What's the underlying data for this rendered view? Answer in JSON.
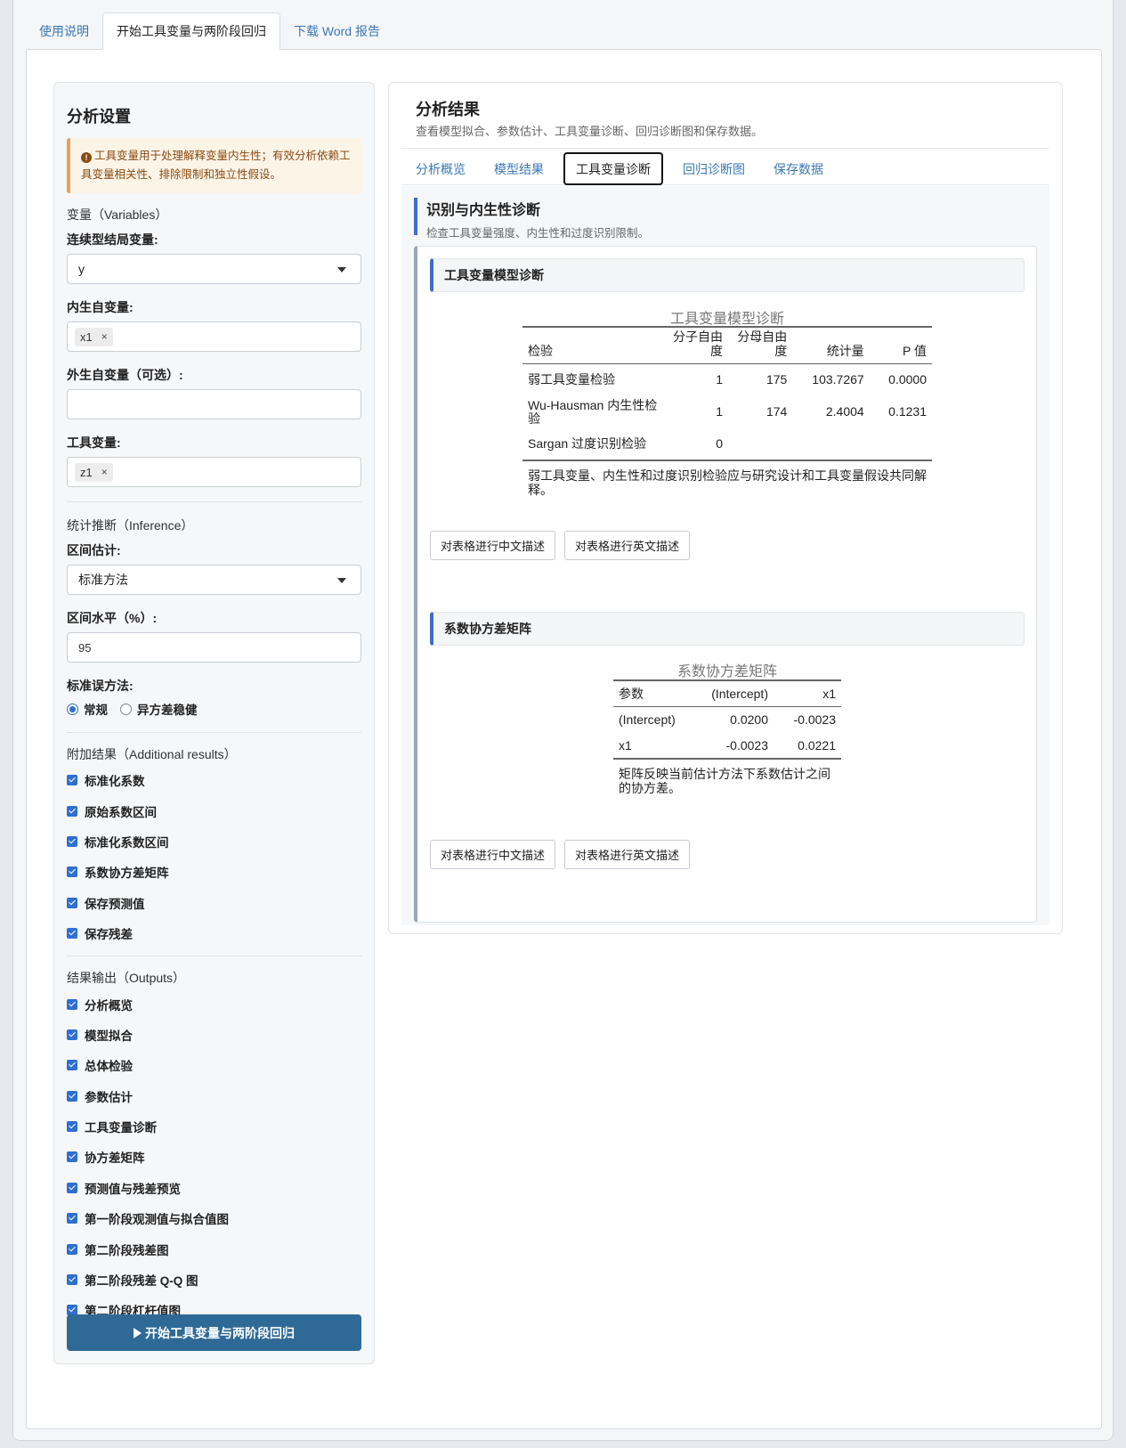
{
  "top_tabs": [
    "使用说明",
    "开始工具变量与两阶段回归",
    "下载 Word 报告"
  ],
  "sidebar": {
    "title": "分析设置",
    "alert": "工具变量用于处理解释变量内生性；有效分析依赖工具变量相关性、排除限制和独立性假设。",
    "variables_title": "变量（Variables）",
    "outcome_label": "连续型结局变量:",
    "outcome_value": "y",
    "endog_label": "内生自变量:",
    "endog_tag": "x1",
    "exog_label": "外生自变量（可选）:",
    "instr_label": "工具变量:",
    "instr_tag": "z1",
    "inference_title": "统计推断（Inference）",
    "interval_label": "区间估计:",
    "interval_value": "标准方法",
    "level_label": "区间水平（%）:",
    "level_value": "95",
    "se_label": "标准误方法:",
    "se_options": [
      "常规",
      "异方差稳健"
    ],
    "se_selected": "常规",
    "additional_title": "附加结果（Additional results）",
    "additional_items": [
      "标准化系数",
      "原始系数区间",
      "标准化系数区间",
      "系数协方差矩阵",
      "保存预测值",
      "保存残差"
    ],
    "outputs_title": "结果输出（Outputs）",
    "output_items": [
      "分析概览",
      "模型拟合",
      "总体检验",
      "参数估计",
      "工具变量诊断",
      "协方差矩阵",
      "预测值与残差预览",
      "第一阶段观测值与拟合值图",
      "第二阶段残差图",
      "第二阶段残差 Q-Q 图",
      "第二阶段杠杆值图"
    ],
    "run_button": "开始工具变量与两阶段回归"
  },
  "results": {
    "title": "分析结果",
    "subtitle": "查看模型拟合、参数估计、工具变量诊断、回归诊断图和保存数据。",
    "tabs": [
      "分析概览",
      "模型结果",
      "工具变量诊断",
      "回归诊断图",
      "保存数据"
    ],
    "active_tab": "工具变量诊断",
    "section_title": "识别与内生性诊断",
    "section_subtitle": "检查工具变量强度、内生性和过度识别限制。",
    "diag": {
      "card_title": "工具变量模型诊断",
      "caption": "工具变量模型诊断",
      "headers": [
        "检验",
        "分子自由度",
        "分母自由度",
        "统计量",
        "P 值"
      ],
      "rows": [
        [
          "弱工具变量检验",
          "1",
          "175",
          "103.7267",
          "0.0000"
        ],
        [
          "Wu-Hausman 内生性检验",
          "1",
          "174",
          "2.4004",
          "0.1231"
        ],
        [
          "Sargan 过度识别检验",
          "0",
          "",
          "",
          ""
        ]
      ],
      "note": "弱工具变量、内生性和过度识别检验应与研究设计和工具变量假设共同解释。"
    },
    "cov": {
      "card_title": "系数协方差矩阵",
      "caption": "系数协方差矩阵",
      "headers": [
        "参数",
        "(Intercept)",
        "x1"
      ],
      "rows": [
        [
          "(Intercept)",
          "0.0200",
          "-0.0023"
        ],
        [
          "x1",
          "-0.0023",
          "0.0221"
        ]
      ],
      "note": "矩阵反映当前估计方法下系数估计之间的协方差。"
    },
    "btn_cn": "对表格进行中文描述",
    "btn_en": "对表格进行英文描述"
  }
}
